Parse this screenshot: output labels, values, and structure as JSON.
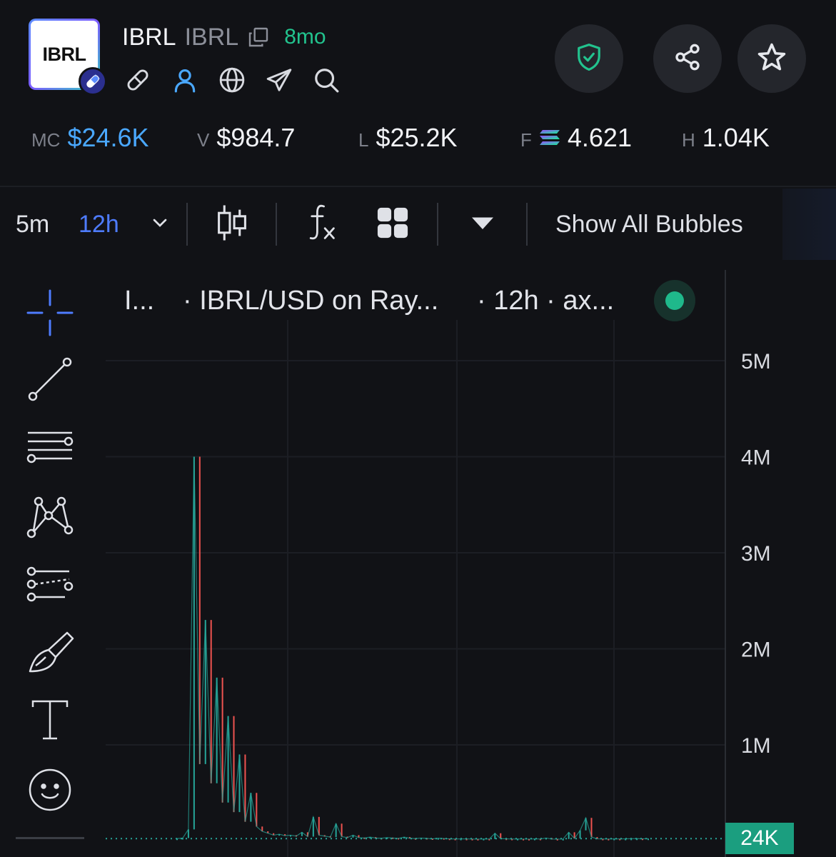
{
  "token": {
    "logo_text": "IBRL",
    "name": "IBRL",
    "ticker": "IBRL",
    "age": "8mo"
  },
  "icons": {
    "copy": "copy-icon",
    "link": "link-icon",
    "user": "user-icon",
    "globe": "globe-icon",
    "telegram": "telegram-icon",
    "search": "search-icon",
    "shield": "shield-check-icon",
    "share": "share-icon",
    "star": "star-icon"
  },
  "stats": [
    {
      "key": "MC",
      "value": "$24.6K"
    },
    {
      "key": "V",
      "value": "$984.7"
    },
    {
      "key": "L",
      "value": "$25.2K"
    },
    {
      "key": "F",
      "value": "4.621"
    },
    {
      "key": "H",
      "value": "1.04K"
    }
  ],
  "toolbar": {
    "interval_1": "5m",
    "interval_2": "12h",
    "bubbles": "Show All Bubbles"
  },
  "chart_header": {
    "seg1": "I...",
    "seg2": "· IBRL/USD on Ray...",
    "seg3": "· 12h · ax..."
  },
  "colors": {
    "accent_blue": "#4aa8ff",
    "up": "#26a69a",
    "down": "#ef5350",
    "age_green": "#22c38e"
  },
  "chart_data": {
    "type": "line",
    "yticks": [
      "5M",
      "4M",
      "3M",
      "2M",
      "1M"
    ],
    "y_tick_values": [
      5000000,
      4000000,
      3000000,
      2000000,
      1000000
    ],
    "ylim": [
      0,
      5600000
    ],
    "last_price_label": "24K",
    "grid": true,
    "series": [
      {
        "values": [
          24000,
          30000,
          120000,
          4000000,
          800000,
          2300000,
          600000,
          1700000,
          400000,
          1300000,
          300000,
          900000,
          200000,
          500000,
          150000,
          100000,
          80000,
          60000,
          70000,
          55000,
          60000,
          50000,
          90000,
          45000,
          250000,
          60000,
          50000,
          40000,
          180000,
          45000,
          35000,
          60000,
          35000,
          30000,
          40000,
          30000,
          28000,
          35000,
          30000,
          26000,
          40000,
          28000,
          24000,
          30000,
          26000,
          22000,
          28000,
          24000,
          22000,
          20000,
          22000,
          21000,
          20000,
          19000,
          21000,
          20000,
          80000,
          24000,
          22000,
          20000,
          21000,
          20000,
          19000,
          22000,
          20000,
          30000,
          20000,
          19000,
          20000,
          90000,
          26000,
          110000,
          240000,
          40000,
          22000,
          21000,
          20000,
          22000,
          21000,
          22000,
          23000,
          24000,
          22000,
          24000
        ]
      }
    ]
  }
}
